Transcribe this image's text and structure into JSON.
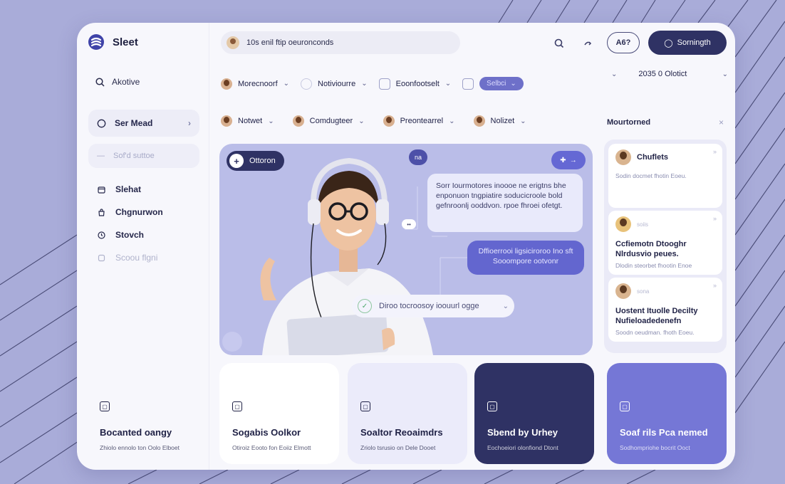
{
  "brand": {
    "name": "Sleet"
  },
  "sidebar": {
    "search_label": "Akotive",
    "pill_label": "Ser Mead",
    "pill2_label": "Sof'd suttoe",
    "items": [
      {
        "label": "Slehat",
        "icon": "calendar-icon",
        "muted": false
      },
      {
        "label": "Chgnurwon",
        "icon": "bag-icon",
        "muted": false
      },
      {
        "label": "Stovch",
        "icon": "clock-icon",
        "muted": false
      },
      {
        "label": "Scoou flgni",
        "icon": "square-icon",
        "muted": true
      }
    ]
  },
  "topbar": {
    "search_text": "10s enil ftip oeuronconds",
    "age_label": "A6?",
    "primary_button": "Sorningth"
  },
  "filters_row1": [
    {
      "label": "Morecnoorf",
      "icon": "photo"
    },
    {
      "label": "Notiviourre",
      "icon": "ring"
    },
    {
      "label": "Eoonfootselt",
      "icon": "sq"
    }
  ],
  "filter_chip": "Selbci",
  "date_filter": "2035 0 Olotict",
  "filters_row2": [
    {
      "label": "Notwet"
    },
    {
      "label": "Comdugteer"
    },
    {
      "label": "Preontearrel"
    },
    {
      "label": "Nolizet"
    }
  ],
  "hero": {
    "top_left_button": "Ottoron",
    "badge": "na",
    "top_right_button": "→",
    "bubble1": "Sorr Iourmotores inoooe ne erigtns bhe enponuon tngpiatire soducicroole bold gefnroonlj ooddvon. rpoe fhroei ofetgt.",
    "bubble2": "Dffioerrooi ligsiciroroo Ino sft Sooompore ootvonr",
    "small_tag": "••",
    "pill_text": "Diroo tocroosoy ioouurl ogge"
  },
  "right_panel": {
    "heading": "Mourtorned",
    "cards": [
      {
        "name": "Chuflets",
        "title": "",
        "desc": "Sodin docmet fhotin Eoeu.",
        "avatar": "a"
      },
      {
        "name": "",
        "sub": "soiis",
        "title": "Ccfiemotn Dtooghr Nlrdusvio peues.",
        "desc": "Dlodin steorbet fhootin Enoe",
        "avatar": "b"
      },
      {
        "name": "",
        "sub": "sona",
        "title": "Uostent Ituolle Decilty Nufieloadedenefn",
        "desc": "Soodn oeudman. fhoth Eoeu.",
        "avatar": "a"
      }
    ]
  },
  "cards": [
    {
      "title": "Bocanted oangy",
      "sub": "Zhiolo ennolo ton Oolo Elboet"
    },
    {
      "title": "Sogabis Oolkor",
      "sub": "Otiroiz Eooto fon Eoiiz Elmott"
    },
    {
      "title": "Soaltor Reoaimdrs",
      "sub": "Zriolo tsrusio on Dele Dooet"
    },
    {
      "title": "Sbend by Urhey",
      "sub": "Eochoeiori olonfiond Dtont"
    },
    {
      "title": "Soaf rils Pca nemed",
      "sub": "Sodhompriohe bocrit Ooct"
    }
  ],
  "colors": {
    "background": "#a9acd9",
    "accent_dark": "#2f3264",
    "accent": "#6366cf",
    "hero_bg": "#babde8"
  }
}
